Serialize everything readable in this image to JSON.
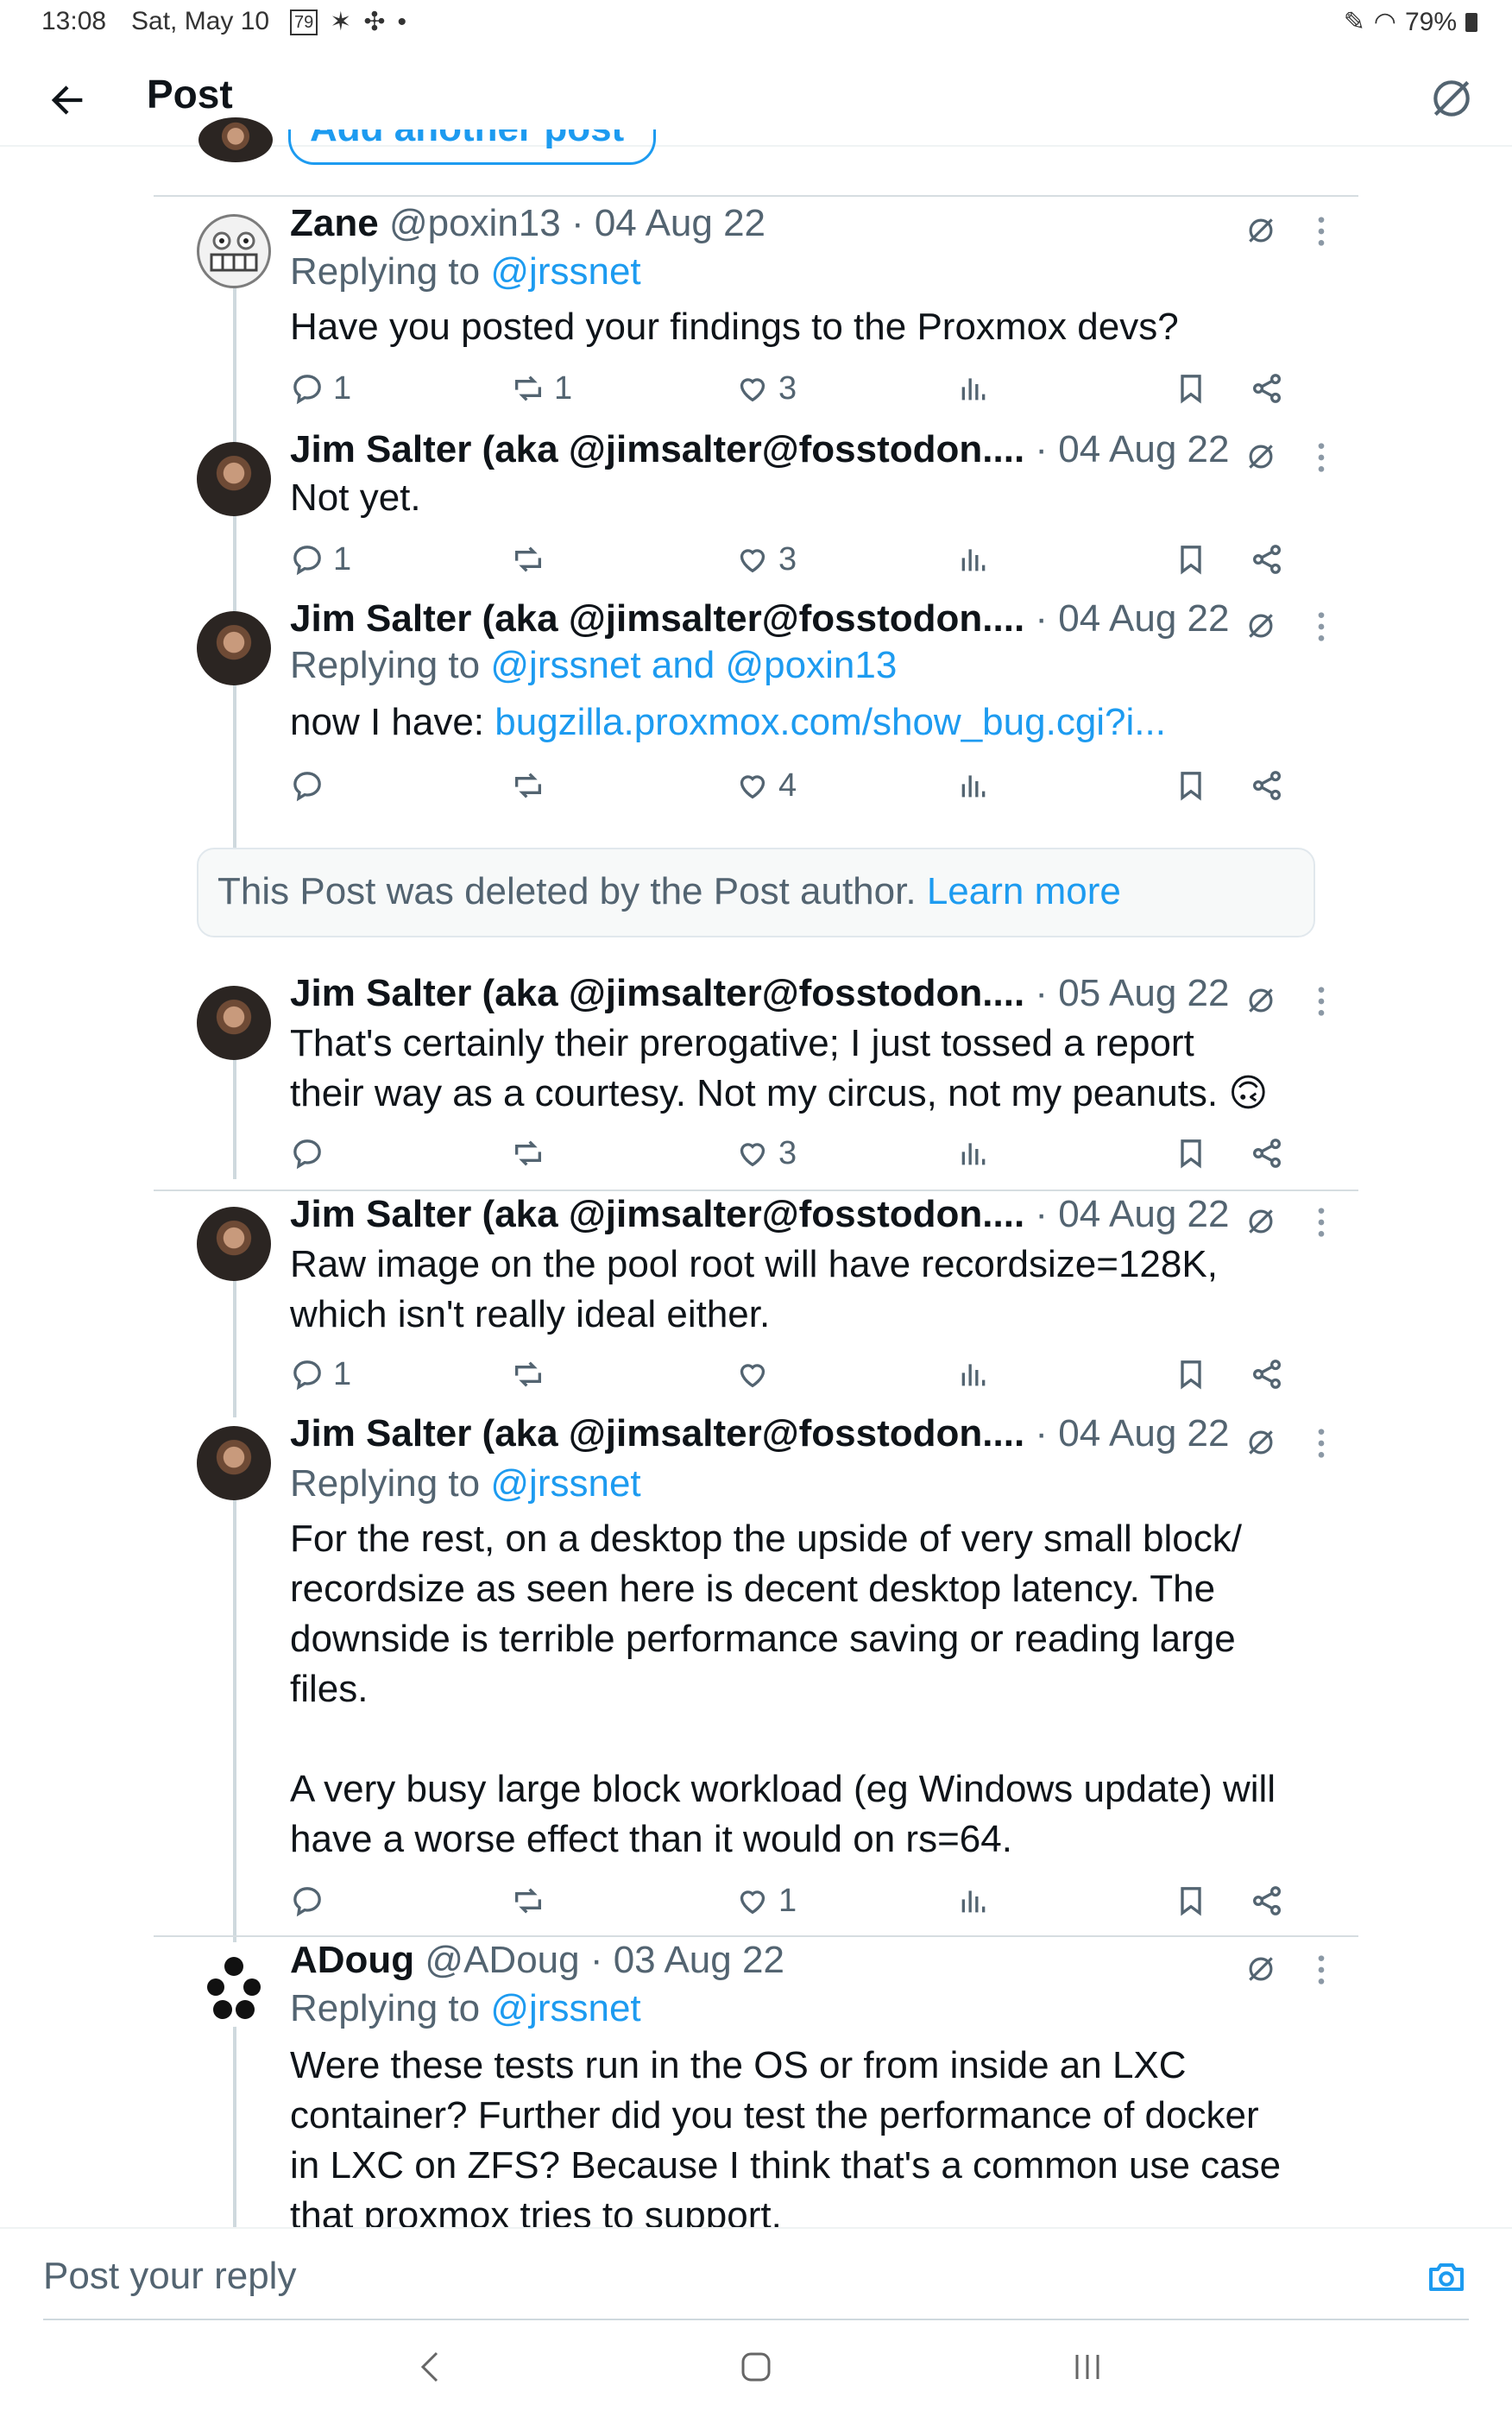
{
  "status_bar": {
    "time": "13:08",
    "date": "Sat, May 10",
    "badge": "79",
    "battery": "79%"
  },
  "header": {
    "title": "Post"
  },
  "top_partial": {
    "label": "Add another post"
  },
  "posts": [
    {
      "name": "Zane",
      "meta": "@poxin13 · 04 Aug 22",
      "replying_prefix": "Replying to",
      "replying_to": "@jrssnet",
      "text": "Have you posted your findings to the Proxmox devs?",
      "replies": "1",
      "reposts": "1",
      "likes": "3"
    },
    {
      "name": "Jim Salter (aka @jimsalter@fosstodon....",
      "meta": " · 04 Aug 22",
      "text": "Not yet.",
      "replies": "1",
      "reposts": "",
      "likes": "3"
    },
    {
      "name": "Jim Salter (aka @jimsalter@fosstodon....",
      "meta": " · 04 Aug 22",
      "replying_prefix": "Replying to",
      "replying_to": "@jrssnet and @poxin13",
      "text_prefix": "now I have: ",
      "text_link": "bugzilla.proxmox.com/show_bug.cgi?i...",
      "replies": "",
      "reposts": "",
      "likes": "4"
    },
    {
      "name": "Jim Salter (aka @jimsalter@fosstodon....",
      "meta": " · 05 Aug 22",
      "text_line1": "That's certainly their prerogative; I just tossed a report",
      "text_line2": "their way as a courtesy. Not my circus, not my peanuts. 🙃",
      "replies": "",
      "reposts": "",
      "likes": "3"
    },
    {
      "name": "Jim Salter (aka @jimsalter@fosstodon....",
      "meta": " · 04 Aug 22",
      "text_line1": "Raw image on the pool root will have recordsize=128K,",
      "text_line2": "which isn't really ideal either.",
      "replies": "1",
      "reposts": "",
      "likes": ""
    },
    {
      "name": "Jim Salter (aka @jimsalter@fosstodon....",
      "meta": " · 04 Aug 22",
      "replying_prefix": "Replying to",
      "replying_to": "@jrssnet",
      "text_lines": [
        "For the rest, on a desktop the upside of very small block/",
        "recordsize as seen here is decent desktop latency. The",
        "downside is terrible performance saving or reading large",
        "files.",
        "",
        "A very busy large block workload (eg Windows update) will",
        "have a worse effect than it would on rs=64."
      ],
      "replies": "",
      "reposts": "",
      "likes": "1"
    },
    {
      "name": "ADoug",
      "meta": " @ADoug · 03 Aug 22",
      "replying_prefix": "Replying to",
      "replying_to": "@jrssnet",
      "text_lines": [
        "Were these tests run in the OS or from inside an LXC",
        "container? Further did you test the performance of docker",
        "in LXC on ZFS? Because I think that's a common use case",
        "that proxmox tries to support."
      ]
    }
  ],
  "deleted_notice": {
    "text": "This Post was deleted by the Post author.",
    "link": "Learn more"
  },
  "reply_bar": {
    "placeholder": "Post your reply"
  },
  "colors": {
    "accent": "#1d9bf0",
    "muted": "#536471",
    "text": "#0f1419"
  }
}
